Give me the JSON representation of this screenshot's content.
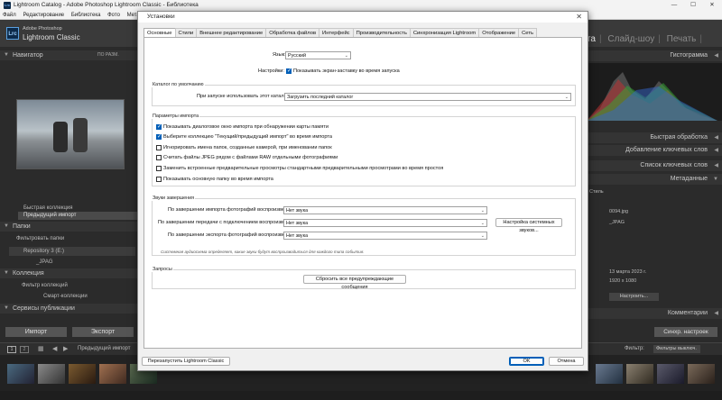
{
  "window": {
    "title": "Lightroom Catalog - Adobe Photoshop Lightroom Classic - Библиотека",
    "menu": [
      "Файл",
      "Редактирование",
      "Библиотека",
      "Фото",
      "Метаданные"
    ]
  },
  "identity": {
    "line1": "Adobe Photoshop",
    "line2": "Lightroom Classic",
    "logo": "Lrc"
  },
  "modules": [
    "Книга",
    "Слайд-шоу",
    "Печать"
  ],
  "left_panel": {
    "navigator": "Навигатор",
    "navigator_fit": "ПО РАЗМ.",
    "collections_items": [
      "Быстрая коллекция",
      "Предыдущий импорт"
    ],
    "folders": "Папки",
    "filter_folders": "Фильтровать папки",
    "volume": "Repository 3 (E:)",
    "folder_item": "_JPAG",
    "collections": "Коллекция",
    "filter_collections": "Фильтр коллекций",
    "smart_collections": "Смарт-коллекции",
    "publish_services": "Сервисы публикации",
    "import_btn": "Импорт",
    "export_btn": "Экспорт"
  },
  "right_panel": {
    "histogram": "Гистограмма",
    "quick_develop": "Быстрая обработка",
    "add_keywords": "Добавление ключевых слов",
    "keyword_list": "Список ключевых слов",
    "metadata": "Метаданные",
    "preset_label": "Стиль",
    "filename": "0094.jpg",
    "folder": "_JPAG",
    "date": "13 марта 2023 г.",
    "dimensions": "1920 x 1080",
    "customize": "Настроить...",
    "comments": "Комментарии",
    "sync_btn": "Синхр. настроек"
  },
  "toolbar": {
    "prev_import": "Предыдущий импорт",
    "filter_label": "Фильтр:",
    "filter_value": "Фильтры выключ."
  },
  "dialog": {
    "title": "Установки",
    "close": "✕",
    "tabs": [
      "Основные",
      "Стили",
      "Внешнее редактирование",
      "Обработка файлов",
      "Интерфейс",
      "Производительность",
      "Синхронизация Lightroom",
      "Отображение",
      "Сеть"
    ],
    "language_label": "Язык:",
    "language_value": "Русский",
    "settings_label": "Настройки:",
    "splash_label": "Показывать экран-заставку во время запуска",
    "splash_checked": true,
    "catalog_group": "Каталог по умолчанию",
    "catalog_label": "При запуске использовать этот каталог:",
    "catalog_value": "Загрузить последний каталог",
    "import_group": "Параметры импорта",
    "import_options": [
      {
        "label": "Показывать диалоговое окно импорта при обнаружении карты памяти",
        "checked": true
      },
      {
        "label": "Выберите коллекцию \"Текущий/предыдущий импорт\" во время импорта",
        "checked": true
      },
      {
        "label": "Игнорировать имена папок, созданные камерой, при именовании папок",
        "checked": false
      },
      {
        "label": "Считать файлы JPEG рядом с файлами RAW отдельными фотографиями",
        "checked": false
      },
      {
        "label": "Заменить встроенные предварительные просмотры стандартными предварительными просмотрами во время простоя",
        "checked": false
      },
      {
        "label": "Показывать основную папку во время импорта",
        "checked": false
      }
    ],
    "sounds_group": "Звуки завершения",
    "sound1_label": "По завершении импорта фотографий воспроизвести:",
    "sound1_value": "Нет звука",
    "sound2_label": "По завершении передачи с подключением воспроизвести:",
    "sound2_value": "Нет звука",
    "sound3_label": "По завершении экспорта фотографий воспроизвести:",
    "sound3_value": "Нет звука",
    "system_sounds_btn": "Настройка системных звуков...",
    "sounds_note": "Системная аудиосхема определяет, какие звуки будут воспроизводиться для каждого типа события.",
    "prompts_group": "Запросы",
    "reset_btn": "Сбросить все предупреждающие сообщения",
    "restart_btn": "Перезапустить Lightroom Classic",
    "ok_btn": "OK",
    "cancel_btn": "Отмена"
  },
  "colors": {
    "accent": "#005fb8",
    "panel": "#2b2b2b"
  }
}
